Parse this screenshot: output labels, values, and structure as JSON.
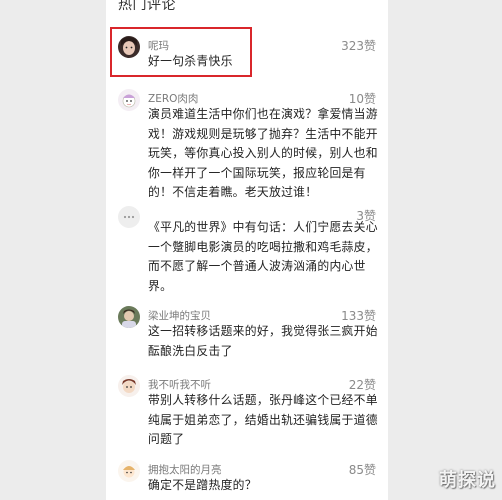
{
  "section_title": "热门评论",
  "comments": [
    {
      "username": "呢玛",
      "likes": "323赞",
      "text": "好一句杀青快乐",
      "avatar": "photo-avatar-icon"
    },
    {
      "username": "ZERO肉肉",
      "likes": "10赞",
      "text": "演员难道生活中你们也在演戏？拿爱情当游戏！游戏规则是玩够了抛弃？生活中不能开玩笑，等你真心投入别人的时候，别人也和你一样开了一个国际玩笑，报应轮回是有的！不信走着瞧。老天放过谁！",
      "avatar": "cartoon-avatar-icon"
    },
    {
      "username": "",
      "likes": "3赞",
      "text": "《平凡的世界》中有句话：人们宁愿去关心一个蹩脚电影演员的吃喝拉撒和鸡毛蒜皮，而不愿了解一个普通人波涛汹涌的内心世界。",
      "avatar": "default-avatar-icon"
    },
    {
      "username": "梁业坤的宝贝",
      "likes": "133赞",
      "text": "这一招转移话题来的好，我觉得张三疯开始酝酿洗白反击了",
      "avatar": "photo-avatar-icon"
    },
    {
      "username": "我不听我不听",
      "likes": "22赞",
      "text": "带别人转移什么话题，张丹峰这个已经不单纯属于姐弟恋了，结婚出轨还骗钱属于道德问题了",
      "avatar": "cartoon-avatar-icon"
    },
    {
      "username": "拥抱太阳的月亮",
      "likes": "85赞",
      "text": "确定不是蹭热度的？",
      "avatar": "cartoon-avatar-icon"
    }
  ],
  "watermark": "萌探说",
  "colors": {
    "highlight": "#d9262b",
    "text": "#222222",
    "meta": "#8a8a8a"
  }
}
